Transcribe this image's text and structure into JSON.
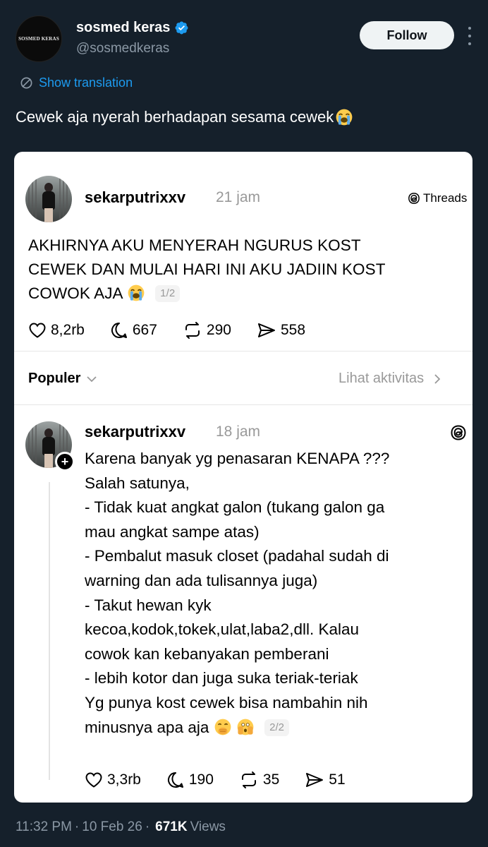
{
  "tweet": {
    "author_name": "sosmed keras",
    "author_handle": "@sosmedkeras",
    "avatar_text": "SOSMED KERAS",
    "follow_label": "Follow",
    "translation_label": "Show translation",
    "text": "Cewek aja nyerah berhadapan sesama cewek",
    "time": "11:32 PM",
    "date": "10 Feb 26",
    "views_count": "671K",
    "views_label": "Views",
    "separator": "·"
  },
  "card": {
    "brand_label": "Threads",
    "post1": {
      "username": "sekarputrixxv",
      "time": "21 jam",
      "lines": [
        "AKHIRNYA AKU MENYERAH NGURUS KOST",
        "CEWEK DAN MULAI HARI INI AKU JADIIN KOST",
        "COWOK AJA"
      ],
      "page": "1/2",
      "likes": "8,2rb",
      "replies": "667",
      "reposts": "290",
      "shares": "558"
    },
    "sort_label": "Populer",
    "activity_label": "Lihat aktivitas",
    "post2": {
      "username": "sekarputrixxv",
      "time": "18 jam",
      "lines": [
        "Karena banyak yg penasaran KENAPA ???",
        "Salah satunya,",
        "- Tidak kuat angkat galon (tukang galon ga",
        "mau angkat sampe atas)",
        "- Pembalut masuk closet (padahal sudah di",
        "warning dan ada tulisannya juga)",
        "- Takut hewan kyk",
        "kecoa,kodok,tokek,ulat,laba2,dll. Kalau",
        "cowok kan kebanyakan pemberani",
        "- lebih kotor dan juga suka teriak-teriak",
        "Yg punya kost cewek bisa nambahin nih",
        "minusnya apa aja"
      ],
      "page": "2/2",
      "likes": "3,3rb",
      "replies": "190",
      "reposts": "35",
      "shares": "51"
    }
  },
  "colors": {
    "background": "#15202b",
    "link": "#1d9bf0",
    "muted": "#8b98a5",
    "verified": "#1d9bf0"
  },
  "icons": [
    "verified-icon",
    "more-icon",
    "translate-icon",
    "crying-emoji",
    "heart-icon",
    "reply-icon",
    "repost-icon",
    "share-icon",
    "threads-logo-icon",
    "chevron-down-icon",
    "chevron-right-icon",
    "plus-icon",
    "hand-over-mouth-emoji",
    "face-with-hands-emoji"
  ]
}
